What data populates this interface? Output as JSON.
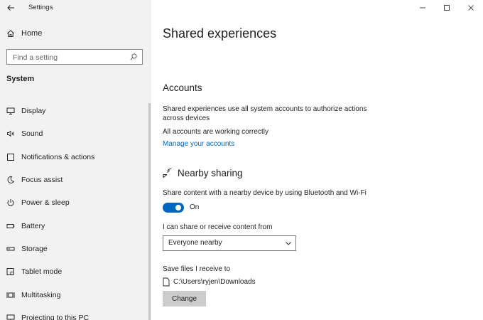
{
  "window": {
    "app_title": "Settings",
    "controls": [
      "minimize",
      "maximize",
      "close"
    ]
  },
  "sidebar": {
    "home_label": "Home",
    "search_placeholder": "Find a setting",
    "section_label": "System",
    "items": [
      {
        "label": "Display",
        "icon": "display-icon"
      },
      {
        "label": "Sound",
        "icon": "speaker-icon"
      },
      {
        "label": "Notifications & actions",
        "icon": "notification-icon"
      },
      {
        "label": "Focus assist",
        "icon": "moon-icon"
      },
      {
        "label": "Power & sleep",
        "icon": "power-icon"
      },
      {
        "label": "Battery",
        "icon": "battery-icon"
      },
      {
        "label": "Storage",
        "icon": "storage-icon"
      },
      {
        "label": "Tablet mode",
        "icon": "tablet-icon"
      },
      {
        "label": "Multitasking",
        "icon": "multitasking-icon"
      },
      {
        "label": "Projecting to this PC",
        "icon": "projector-icon"
      }
    ]
  },
  "main": {
    "title": "Shared experiences",
    "accounts": {
      "heading": "Accounts",
      "description": "Shared experiences use all system accounts to authorize actions across devices",
      "status": "All accounts are working correctly",
      "manage_link": "Manage your accounts"
    },
    "nearby": {
      "heading": "Nearby sharing",
      "description": "Share content with a nearby device by using Bluetooth and Wi-Fi",
      "toggle_state": "On",
      "share_label": "I can share or receive content from",
      "share_value": "Everyone nearby",
      "save_label": "Save files I receive to",
      "save_path": "C:\\Users\\ryjen\\Downloads",
      "change_button": "Change"
    }
  },
  "colors": {
    "accent": "#0067c0",
    "sidebar_bg": "#f2f2f2",
    "button_bg": "#cccccc"
  }
}
